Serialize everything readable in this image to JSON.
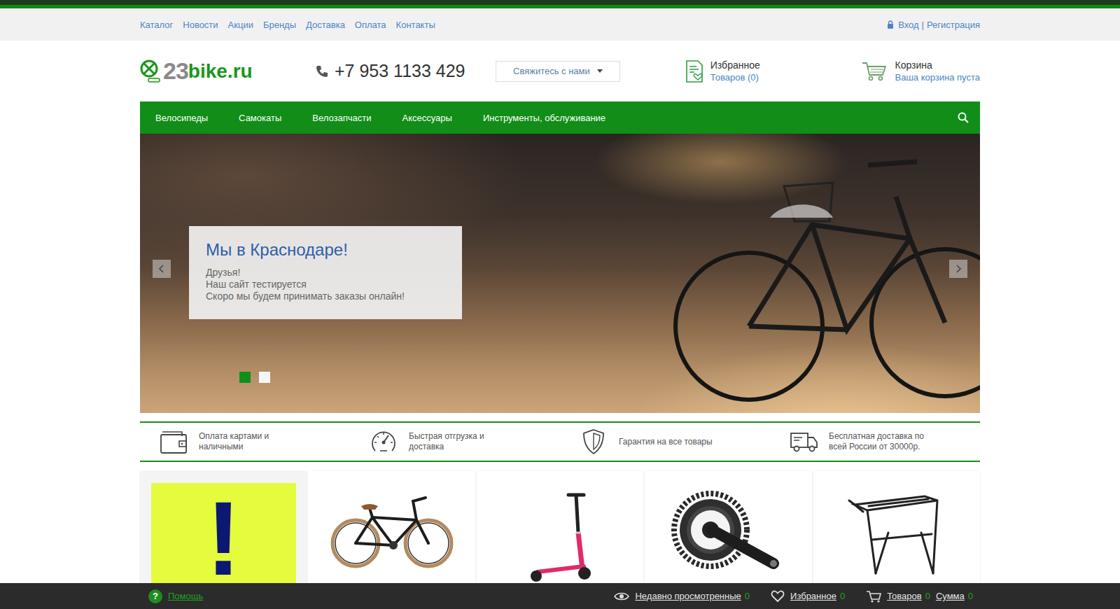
{
  "top_nav": {
    "links": [
      "Каталог",
      "Новости",
      "Акции",
      "Бренды",
      "Доставка",
      "Оплата",
      "Контакты"
    ],
    "login": "Вход",
    "separator": "|",
    "register": "Регистрация"
  },
  "header": {
    "logo": {
      "number": "23",
      "name": "bike.ru"
    },
    "phone": "+7 953 1133 429",
    "contact_button": "Свяжитесь с нами",
    "favorites": {
      "title": "Избранное",
      "count": "Товаров (0)"
    },
    "cart": {
      "title": "Корзина",
      "status": "Ваша корзина пуста"
    }
  },
  "main_menu": {
    "items": [
      "Велосипеды",
      "Самокаты",
      "Велозапчасти",
      "Аксессуары",
      "Инструменты, обслуживание"
    ]
  },
  "slider": {
    "title": "Мы в Краснодаре!",
    "lines": [
      "Друзья!",
      "Наш сайт тестируется",
      "Скоро мы будем принимать заказы онлайн!"
    ],
    "dots": [
      {
        "selected": true
      },
      {
        "selected": false
      }
    ]
  },
  "features": [
    {
      "lines": [
        "Оплата картами и",
        "наличными"
      ]
    },
    {
      "lines": [
        "Быстрая отгрузка и",
        "доставка"
      ]
    },
    {
      "lines": [
        "Гарантия на все товары"
      ]
    },
    {
      "lines": [
        "Бесплатная доставка по",
        "всей России от 30000р."
      ]
    }
  ],
  "products": [
    {
      "kind": "promo",
      "label": "!"
    },
    {
      "kind": "product"
    },
    {
      "kind": "product"
    },
    {
      "kind": "product"
    },
    {
      "kind": "product"
    }
  ],
  "bottom_bar": {
    "help": {
      "icon": "?",
      "label": "Помощь"
    },
    "recent": {
      "label": "Недавно просмотренные",
      "count": "0"
    },
    "favorites": {
      "label": "Избранное",
      "count": "0"
    },
    "cart": {
      "items_label": "Товаров",
      "items_count": "0",
      "sum_label": "Сумма",
      "sum_count": "0"
    }
  }
}
